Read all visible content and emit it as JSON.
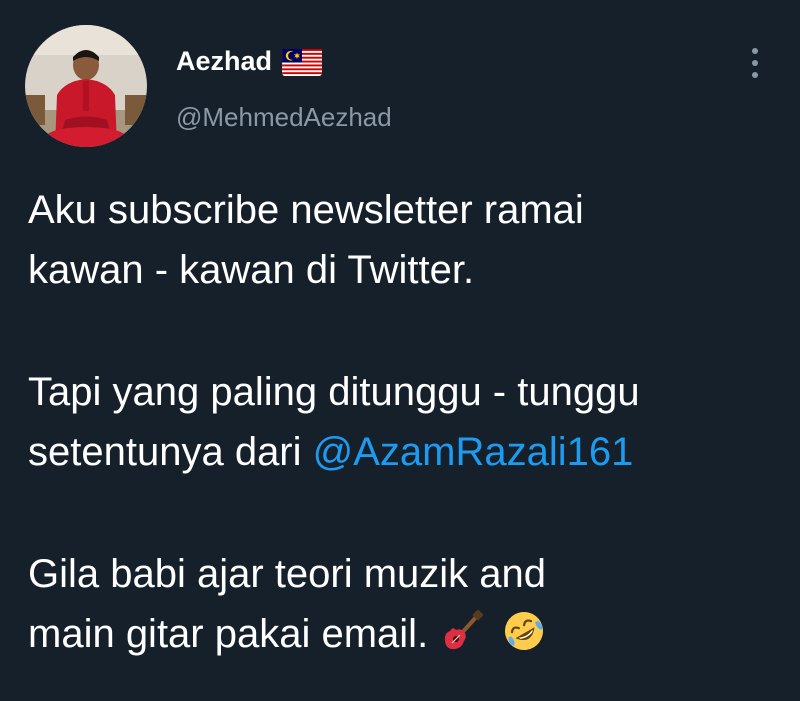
{
  "tweet": {
    "author": {
      "display_name": "Aezhad",
      "handle": "@MehmedAezhad",
      "flag_icon": "malaysia-flag-icon",
      "avatar_icon": "profile-photo"
    },
    "more_icon": "more-vertical-icon",
    "lines": {
      "p1_l1": "Aku subscribe newsletter ramai",
      "p1_l2": "kawan - kawan di Twitter.",
      "p2_l1": "Tapi yang paling ditunggu - tunggu",
      "p2_l2_prefix": "setentunya dari ",
      "p2_mention": "@AzamRazali161",
      "p3_l1": "Gila babi ajar teori muzik and",
      "p3_l2": "main gitar pakai email."
    },
    "emojis": [
      "guitar-emoji",
      "rolling-on-floor-laughing-emoji"
    ],
    "colors": {
      "background": "#15202b",
      "text": "#ffffff",
      "secondary_text": "#8b98a5",
      "link": "#1d9bf0"
    }
  }
}
